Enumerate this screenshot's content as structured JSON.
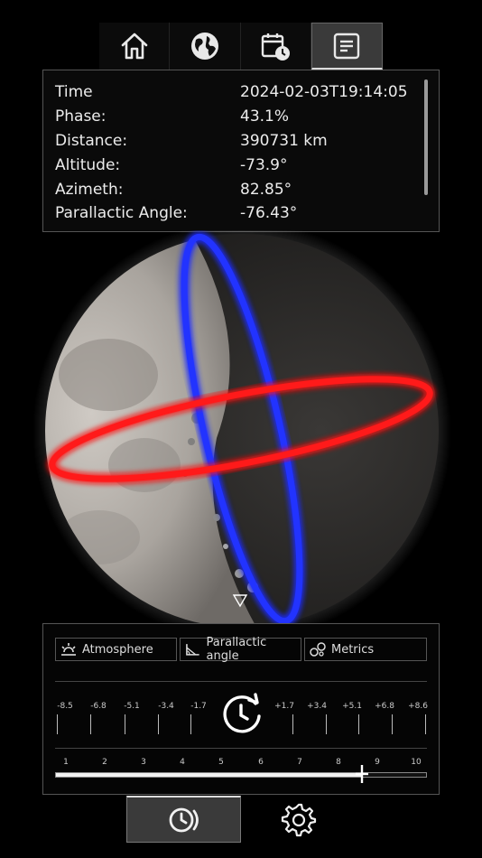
{
  "top_tabs": [
    {
      "icon": "home-icon",
      "active": false
    },
    {
      "icon": "globe-icon",
      "active": false
    },
    {
      "icon": "calendar-clock-icon",
      "active": false
    },
    {
      "icon": "document-icon",
      "active": true
    }
  ],
  "info": {
    "rows": [
      {
        "label": "Time",
        "value": "2024-02-03T19:14:05"
      },
      {
        "label": "Phase:",
        "value": "43.1%"
      },
      {
        "label": "Distance:",
        "value": "390731 km"
      },
      {
        "label": "Altitude:",
        "value": "-73.9°"
      },
      {
        "label": "Azimeth:",
        "value": "82.85°"
      },
      {
        "label": "Parallactic Angle:",
        "value": "-76.43°"
      }
    ]
  },
  "moon": {
    "ring_colors": {
      "horizontal": "#ff1010",
      "vertical": "#1a2cff"
    }
  },
  "controls": {
    "chips": {
      "atmosphere": "Atmosphere",
      "parallactic": "Parallactic angle",
      "metrics": "Metrics"
    },
    "ticks": [
      "-8.5",
      "-6.8",
      "-5.1",
      "-3.4",
      "-1.7",
      "+1.7",
      "+3.4",
      "+5.1",
      "+6.8",
      "+8.6"
    ],
    "scale": [
      "1",
      "2",
      "3",
      "4",
      "5",
      "6",
      "7",
      "8",
      "9",
      "10"
    ],
    "slider_value": 8.6,
    "slider_min": 1,
    "slider_max": 10
  },
  "bottom_tabs": [
    {
      "icon": "clock-orbit-icon",
      "active": true
    },
    {
      "icon": "gear-icon",
      "active": false
    }
  ]
}
